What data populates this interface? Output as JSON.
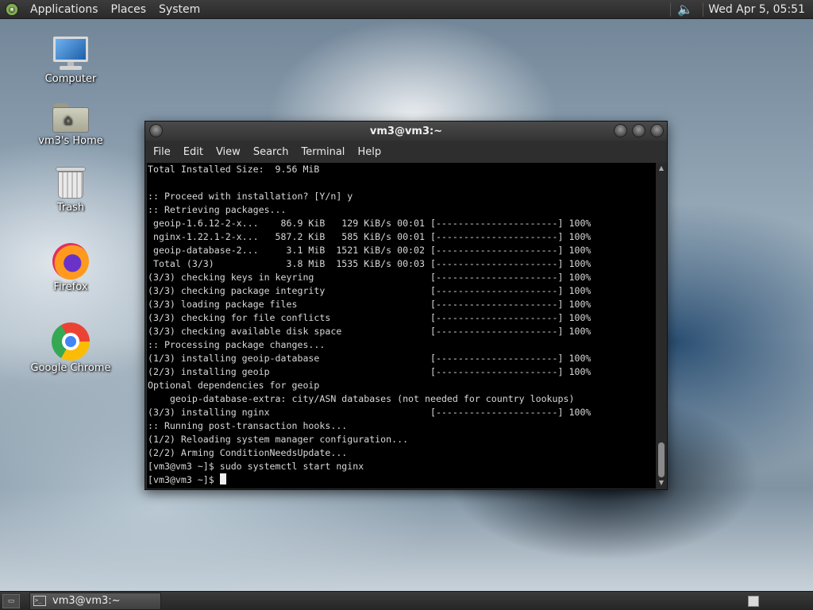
{
  "top_panel": {
    "menus": [
      "Applications",
      "Places",
      "System"
    ],
    "volume_icon": "speaker-icon",
    "clock": "Wed Apr  5, 05:51"
  },
  "desktop_icons": [
    {
      "label": "Computer",
      "icon": "computer-icon"
    },
    {
      "label": "vm3's Home",
      "icon": "home-folder-icon"
    },
    {
      "label": "Trash",
      "icon": "trash-icon"
    },
    {
      "label": "Firefox",
      "icon": "firefox-icon"
    },
    {
      "label": "Google Chrome",
      "icon": "chrome-icon"
    }
  ],
  "terminal": {
    "title": "vm3@vm3:~",
    "menu": [
      "File",
      "Edit",
      "View",
      "Search",
      "Terminal",
      "Help"
    ],
    "lines": [
      "Total Installed Size:  9.56 MiB",
      "",
      ":: Proceed with installation? [Y/n] y",
      ":: Retrieving packages...",
      " geoip-1.6.12-2-x...    86.9 KiB   129 KiB/s 00:01 [----------------------] 100%",
      " nginx-1.22.1-2-x...   587.2 KiB   585 KiB/s 00:01 [----------------------] 100%",
      " geoip-database-2...     3.1 MiB  1521 KiB/s 00:02 [----------------------] 100%",
      " Total (3/3)             3.8 MiB  1535 KiB/s 00:03 [----------------------] 100%",
      "(3/3) checking keys in keyring                     [----------------------] 100%",
      "(3/3) checking package integrity                   [----------------------] 100%",
      "(3/3) loading package files                        [----------------------] 100%",
      "(3/3) checking for file conflicts                  [----------------------] 100%",
      "(3/3) checking available disk space                [----------------------] 100%",
      ":: Processing package changes...",
      "(1/3) installing geoip-database                    [----------------------] 100%",
      "(2/3) installing geoip                             [----------------------] 100%",
      "Optional dependencies for geoip",
      "    geoip-database-extra: city/ASN databases (not needed for country lookups)",
      "(3/3) installing nginx                             [----------------------] 100%",
      ":: Running post-transaction hooks...",
      "(1/2) Reloading system manager configuration...",
      "(2/2) Arming ConditionNeedsUpdate...",
      "[vm3@vm3 ~]$ sudo systemctl start nginx"
    ],
    "prompt": "[vm3@vm3 ~]$ "
  },
  "taskbar": {
    "window_button": "vm3@vm3:~"
  }
}
